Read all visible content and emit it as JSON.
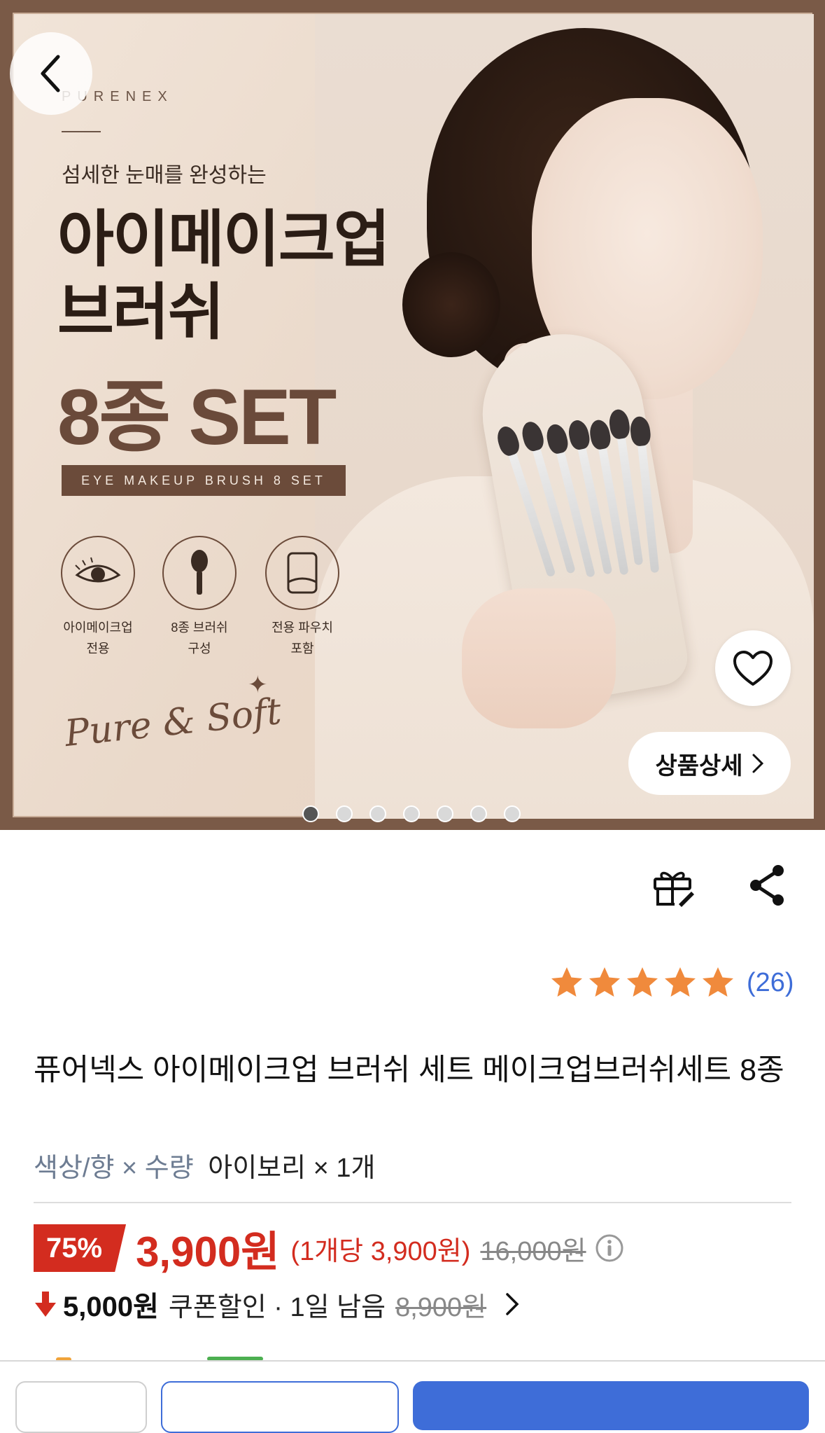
{
  "banner": {
    "brand": "PURENEX",
    "subtitle": "섬세한 눈매를 완성하는",
    "headline_line1": "아이메이크업",
    "headline_line2": "브러쉬",
    "headline_line3": "8종 SET",
    "tag": "EYE MAKEUP BRUSH 8 SET",
    "features": [
      {
        "line1": "아이메이크업",
        "line2": "전용",
        "icon": "eye-icon"
      },
      {
        "line1": "8종 브러쉬",
        "line2": "구성",
        "icon": "brush-icon"
      },
      {
        "line1": "전용 파우치",
        "line2": "포함",
        "icon": "pouch-icon"
      }
    ],
    "script_text": "Pure & Soft",
    "detail_button": "상품상세",
    "carousel": {
      "total": 7,
      "active": 1
    }
  },
  "nav": {
    "back_icon": "chevron-left-icon",
    "wishlist_icon": "heart-icon"
  },
  "actions": {
    "gift_icon": "gift-icon",
    "share_icon": "share-icon"
  },
  "rating": {
    "stars": 5,
    "review_count": "(26)",
    "star_color": "#f08a3c"
  },
  "product": {
    "title": "퓨어넥스 아이메이크업 브러쉬 세트 메이크업브러쉬세트 8종",
    "option_label": "색상/향 × 수량",
    "option_value": "아이보리 × 1개"
  },
  "pricing": {
    "discount": "75%",
    "price": "3,900원",
    "unit_price": "(1개당 3,900원)",
    "original_price": "16,000원",
    "coupon_amount": "5,000원",
    "coupon_text": "쿠폰할인 · 1일 남음",
    "coupon_original": "8,900원",
    "accent_color": "#d32c1f"
  },
  "colors": {
    "primary_blue": "#3e6dd8",
    "frame_brown": "#7a5a47"
  }
}
